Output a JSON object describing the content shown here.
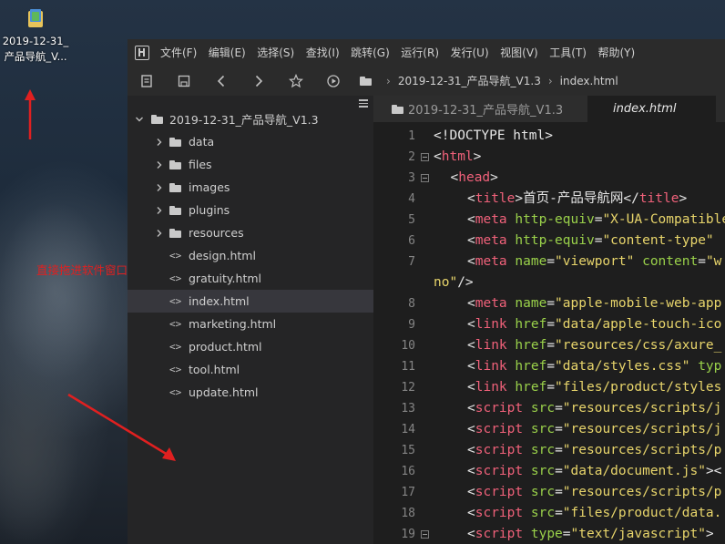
{
  "desktop": {
    "icon_label_line1": "2019-12-31_",
    "icon_label_line2": "产品导航_V...",
    "annotation": "直接拖进软件窗口就可以了",
    "annotation_color": "#e02020"
  },
  "menubar": {
    "items": [
      "文件(F)",
      "编辑(E)",
      "选择(S)",
      "查找(I)",
      "跳转(G)",
      "运行(R)",
      "发行(U)",
      "视图(V)",
      "工具(T)",
      "帮助(Y)"
    ]
  },
  "toolbar": {
    "icons": [
      "new-file-icon",
      "save-icon",
      "back-icon",
      "forward-icon",
      "star-icon",
      "run-icon"
    ],
    "breadcrumb": [
      "2019-12-31_产品导航_V1.3",
      "index.html"
    ]
  },
  "sidebar": {
    "root": "2019-12-31_产品导航_V1.3",
    "folders": [
      "data",
      "files",
      "images",
      "plugins",
      "resources"
    ],
    "files": [
      "design.html",
      "gratuity.html",
      "index.html",
      "marketing.html",
      "product.html",
      "tool.html",
      "update.html"
    ],
    "selected": "index.html"
  },
  "tabs": [
    {
      "label": "2019-12-31_产品导航_V1.3",
      "active": false
    },
    {
      "label": "index.html",
      "active": true
    }
  ],
  "colors": {
    "tag": "#f0617a",
    "attribute": "#9ad14a",
    "string": "#e8d56b"
  },
  "code": {
    "lines": [
      {
        "n": "1",
        "fold": false,
        "ind": 0,
        "t": [
          [
            "p",
            "<!DOCTYPE html>"
          ]
        ]
      },
      {
        "n": "2",
        "fold": true,
        "ind": 0,
        "t": [
          [
            "p",
            "<"
          ],
          [
            "g",
            "html"
          ],
          [
            "p",
            ">"
          ]
        ]
      },
      {
        "n": "3",
        "fold": true,
        "ind": 1,
        "t": [
          [
            "p",
            "<"
          ],
          [
            "g",
            "head"
          ],
          [
            "p",
            ">"
          ]
        ]
      },
      {
        "n": "4",
        "fold": false,
        "ind": 2,
        "t": [
          [
            "p",
            "<"
          ],
          [
            "g",
            "title"
          ],
          [
            "p",
            ">首页-产品导航网</"
          ],
          [
            "g",
            "title"
          ],
          [
            "p",
            ">"
          ]
        ]
      },
      {
        "n": "5",
        "fold": false,
        "ind": 2,
        "t": [
          [
            "p",
            "<"
          ],
          [
            "g",
            "meta"
          ],
          [
            "p",
            " "
          ],
          [
            "a",
            "http-equiv"
          ],
          [
            "p",
            "="
          ],
          [
            "s",
            "\"X-UA-Compatible\""
          ]
        ]
      },
      {
        "n": "6",
        "fold": false,
        "ind": 2,
        "t": [
          [
            "p",
            "<"
          ],
          [
            "g",
            "meta"
          ],
          [
            "p",
            " "
          ],
          [
            "a",
            "http-equiv"
          ],
          [
            "p",
            "="
          ],
          [
            "s",
            "\"content-type\""
          ]
        ]
      },
      {
        "n": "7",
        "fold": false,
        "ind": 2,
        "t": [
          [
            "p",
            "<"
          ],
          [
            "g",
            "meta"
          ],
          [
            "p",
            " "
          ],
          [
            "a",
            "name"
          ],
          [
            "p",
            "="
          ],
          [
            "s",
            "\"viewport\""
          ],
          [
            "p",
            " "
          ],
          [
            "a",
            "content"
          ],
          [
            "p",
            "="
          ],
          [
            "s",
            "\"w"
          ]
        ]
      },
      {
        "n": "",
        "fold": false,
        "ind": -1,
        "t": [
          [
            "s",
            "no\""
          ],
          [
            "p",
            "/>"
          ]
        ]
      },
      {
        "n": "8",
        "fold": false,
        "ind": 2,
        "t": [
          [
            "p",
            "<"
          ],
          [
            "g",
            "meta"
          ],
          [
            "p",
            " "
          ],
          [
            "a",
            "name"
          ],
          [
            "p",
            "="
          ],
          [
            "s",
            "\"apple-mobile-web-app"
          ]
        ]
      },
      {
        "n": "9",
        "fold": false,
        "ind": 2,
        "t": [
          [
            "p",
            "<"
          ],
          [
            "g",
            "link"
          ],
          [
            "p",
            " "
          ],
          [
            "a",
            "href"
          ],
          [
            "p",
            "="
          ],
          [
            "s",
            "\"data/apple-touch-ico"
          ]
        ]
      },
      {
        "n": "10",
        "fold": false,
        "ind": 2,
        "t": [
          [
            "p",
            "<"
          ],
          [
            "g",
            "link"
          ],
          [
            "p",
            " "
          ],
          [
            "a",
            "href"
          ],
          [
            "p",
            "="
          ],
          [
            "s",
            "\"resources/css/axure_"
          ]
        ]
      },
      {
        "n": "11",
        "fold": false,
        "ind": 2,
        "t": [
          [
            "p",
            "<"
          ],
          [
            "g",
            "link"
          ],
          [
            "p",
            " "
          ],
          [
            "a",
            "href"
          ],
          [
            "p",
            "="
          ],
          [
            "s",
            "\"data/styles.css\""
          ],
          [
            "p",
            " "
          ],
          [
            "a",
            "typ"
          ]
        ]
      },
      {
        "n": "12",
        "fold": false,
        "ind": 2,
        "t": [
          [
            "p",
            "<"
          ],
          [
            "g",
            "link"
          ],
          [
            "p",
            " "
          ],
          [
            "a",
            "href"
          ],
          [
            "p",
            "="
          ],
          [
            "s",
            "\"files/product/styles"
          ]
        ]
      },
      {
        "n": "13",
        "fold": false,
        "ind": 2,
        "t": [
          [
            "p",
            "<"
          ],
          [
            "g",
            "script"
          ],
          [
            "p",
            " "
          ],
          [
            "a",
            "src"
          ],
          [
            "p",
            "="
          ],
          [
            "s",
            "\"resources/scripts/j"
          ]
        ]
      },
      {
        "n": "14",
        "fold": false,
        "ind": 2,
        "t": [
          [
            "p",
            "<"
          ],
          [
            "g",
            "script"
          ],
          [
            "p",
            " "
          ],
          [
            "a",
            "src"
          ],
          [
            "p",
            "="
          ],
          [
            "s",
            "\"resources/scripts/j"
          ]
        ]
      },
      {
        "n": "15",
        "fold": false,
        "ind": 2,
        "t": [
          [
            "p",
            "<"
          ],
          [
            "g",
            "script"
          ],
          [
            "p",
            " "
          ],
          [
            "a",
            "src"
          ],
          [
            "p",
            "="
          ],
          [
            "s",
            "\"resources/scripts/p"
          ]
        ]
      },
      {
        "n": "16",
        "fold": false,
        "ind": 2,
        "t": [
          [
            "p",
            "<"
          ],
          [
            "g",
            "script"
          ],
          [
            "p",
            " "
          ],
          [
            "a",
            "src"
          ],
          [
            "p",
            "="
          ],
          [
            "s",
            "\"data/document.js\""
          ],
          [
            "p",
            "><"
          ]
        ]
      },
      {
        "n": "17",
        "fold": false,
        "ind": 2,
        "t": [
          [
            "p",
            "<"
          ],
          [
            "g",
            "script"
          ],
          [
            "p",
            " "
          ],
          [
            "a",
            "src"
          ],
          [
            "p",
            "="
          ],
          [
            "s",
            "\"resources/scripts/p"
          ]
        ]
      },
      {
        "n": "18",
        "fold": false,
        "ind": 2,
        "t": [
          [
            "p",
            "<"
          ],
          [
            "g",
            "script"
          ],
          [
            "p",
            " "
          ],
          [
            "a",
            "src"
          ],
          [
            "p",
            "="
          ],
          [
            "s",
            "\"files/product/data."
          ]
        ]
      },
      {
        "n": "19",
        "fold": true,
        "ind": 2,
        "t": [
          [
            "p",
            "<"
          ],
          [
            "g",
            "script"
          ],
          [
            "p",
            " "
          ],
          [
            "a",
            "type"
          ],
          [
            "p",
            "="
          ],
          [
            "s",
            "\"text/javascript\""
          ],
          [
            "p",
            ">"
          ]
        ]
      }
    ]
  }
}
